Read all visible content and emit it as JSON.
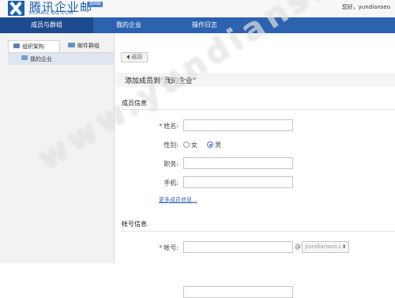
{
  "header": {
    "logo_title": "腾讯企业邮",
    "logo_subtitle": "EXMAIL.QQ.COM",
    "logo_badge": "基础版",
    "greeting": "您好，yundianseo"
  },
  "nav": {
    "items": [
      {
        "label": "成员与群组",
        "active": true
      },
      {
        "label": "我的企业",
        "active": false
      },
      {
        "label": "操作日志",
        "active": false
      }
    ]
  },
  "sidebar": {
    "tabs": [
      {
        "label": "组织架构",
        "icon": "folder-icon",
        "active": true
      },
      {
        "label": "邮件群组",
        "icon": "mail-icon",
        "active": false
      }
    ],
    "tree": [
      {
        "label": "我的企业",
        "icon": "folder-icon"
      }
    ]
  },
  "main": {
    "back_label": "返回",
    "heading": "添加成员到“我的企业”",
    "member_section": {
      "title": "成员信息",
      "name_label": "姓名:",
      "gender_label": "性别:",
      "gender_female": "女",
      "gender_male": "男",
      "gender_selected": "男",
      "position_label": "职务:",
      "phone_label": "手机:",
      "more_link": "更多成员信息..."
    },
    "account_section": {
      "title": "帐号信息",
      "account_label": "帐号:",
      "at": "@",
      "domain_value": "yundianseo.c"
    }
  },
  "watermark": "www.yundiansheo.com",
  "colors": {
    "brand": "#2c62b0",
    "nav_active": "#1c4a8e",
    "required": "#d8261c"
  }
}
